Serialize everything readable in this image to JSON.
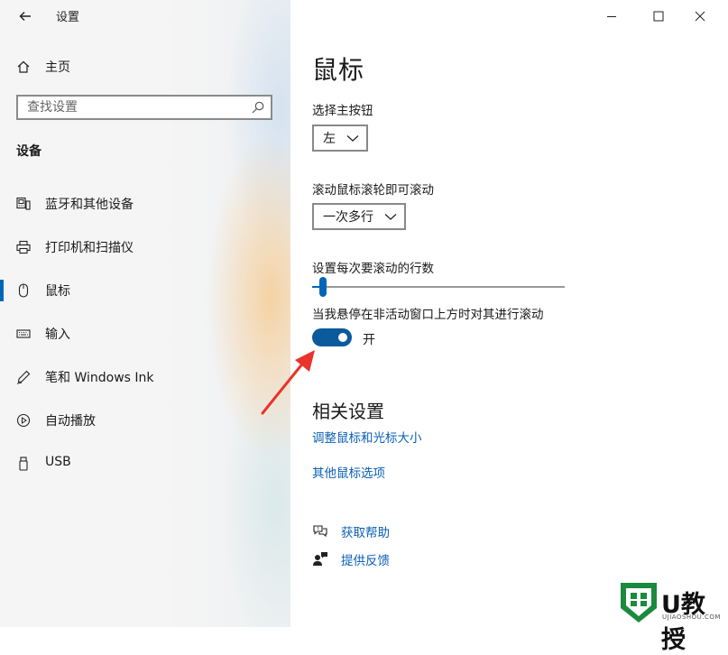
{
  "window": {
    "title": "设置",
    "controls": {
      "minimize": "minimize-icon",
      "maximize": "maximize-icon",
      "close": "close-icon"
    }
  },
  "sidebar": {
    "back_icon": "arrow-left-icon",
    "home_label": "主页",
    "search_placeholder": "查找设置",
    "section_title": "设备",
    "items": [
      {
        "label": "蓝牙和其他设备",
        "icon": "bluetooth-devices-icon"
      },
      {
        "label": "打印机和扫描仪",
        "icon": "printer-icon"
      },
      {
        "label": "鼠标",
        "icon": "mouse-icon",
        "selected": true
      },
      {
        "label": "输入",
        "icon": "keyboard-icon"
      },
      {
        "label": "笔和 Windows Ink",
        "icon": "pen-icon"
      },
      {
        "label": "自动播放",
        "icon": "autoplay-icon"
      },
      {
        "label": "USB",
        "icon": "usb-icon"
      }
    ]
  },
  "main": {
    "title": "鼠标",
    "primary_button": {
      "label": "选择主按钮",
      "value": "左"
    },
    "wheel_scroll": {
      "label": "滚动鼠标滚轮即可滚动",
      "value": "一次多行"
    },
    "lines_to_scroll": {
      "label": "设置每次要滚动的行数",
      "fraction": 0.03
    },
    "inactive_scroll": {
      "label": "当我悬停在非活动窗口上方时对其进行滚动",
      "state": "开",
      "on": true
    },
    "related": {
      "title": "相关设置",
      "links": [
        "调整鼠标和光标大小",
        "其他鼠标选项"
      ]
    },
    "help": {
      "get_help": "获取帮助",
      "feedback": "提供反馈"
    }
  },
  "colors": {
    "accent": "#0067b8",
    "toggle_on": "#0a5a9c",
    "link": "#0a5fb4",
    "arrow": "#e8342c"
  },
  "watermark": {
    "brand": "U教授",
    "site": "UJIAOSHOU.COM"
  }
}
